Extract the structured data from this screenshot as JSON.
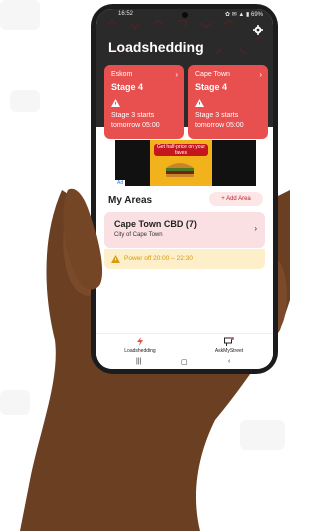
{
  "status_bar": {
    "time": "16:52",
    "icons": "✿ ✉ ▲ ▮ 69%"
  },
  "app": {
    "title": "Loadshedding"
  },
  "cards": [
    {
      "provider": "Eskom",
      "stage": "Stage 4",
      "next": "Stage 3 starts tomorrow 05:00"
    },
    {
      "provider": "Cape Town",
      "stage": "Stage 4",
      "next": "Stage 3 starts tomorrow 05:00"
    }
  ],
  "ad": {
    "banner_text": "Get half-price on your faves",
    "badge": "Ad"
  },
  "my_areas": {
    "title": "My Areas",
    "add_label": "+ Add Area",
    "areas": [
      {
        "name": "Cape Town CBD (7)",
        "city": "City of Cape Town",
        "power_off": "Power off 20:00 – 22:30"
      }
    ]
  },
  "bottom_nav": [
    {
      "label": "Loadshedding"
    },
    {
      "label": "AskMyStreet"
    }
  ],
  "colors": {
    "accent": "#e84f4f",
    "warning": "#d79a10"
  }
}
